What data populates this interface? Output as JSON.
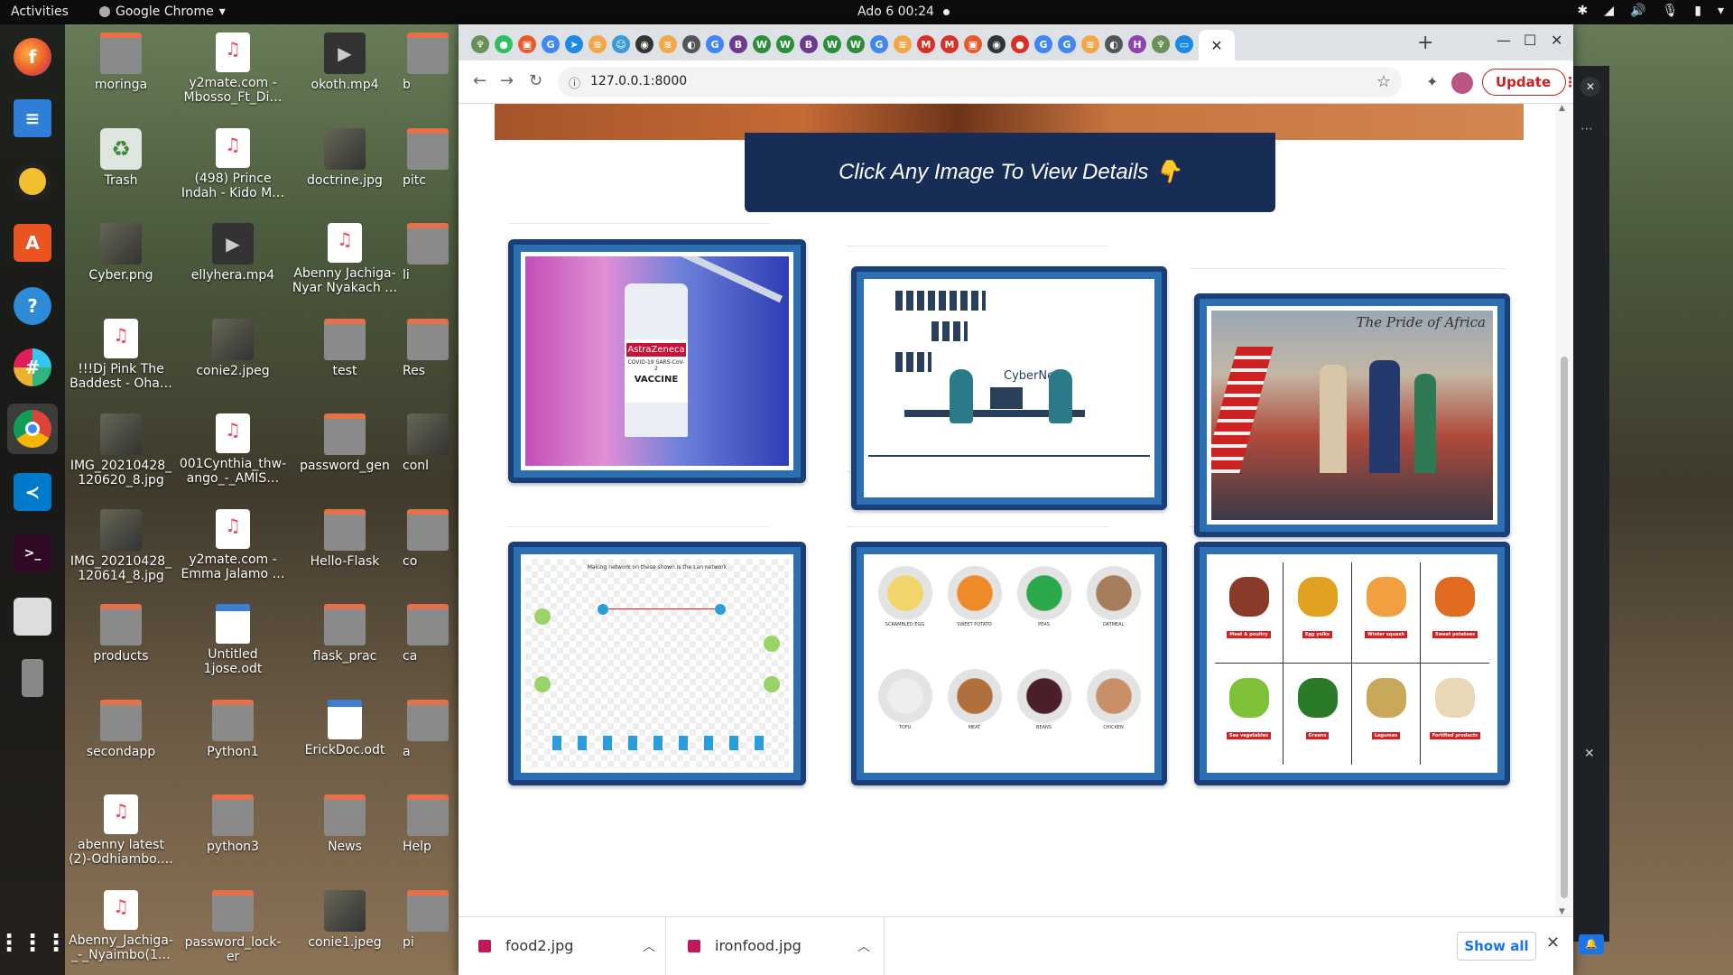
{
  "topbar": {
    "activities": "Activities",
    "app_name": "Google Chrome",
    "clock": "Ado 6  00:24"
  },
  "dock": [
    "firefox-icon",
    "writer-icon",
    "rhythmbox-icon",
    "software-icon",
    "help-icon",
    "slack-icon",
    "chrome-icon",
    "vscode-icon",
    "terminal-icon",
    "files-icon",
    "removable-drive-icon",
    "app-grid-icon"
  ],
  "desktop": {
    "col1": [
      "moringa",
      "Trash",
      "Cyber.png",
      "!!!Dj Pink The Baddest - Oha…",
      "IMG_20210428_\n120620_8.jpg",
      "IMG_20210428_\n120614_8.jpg",
      "products",
      "secondapp",
      "abenny latest (2)-Odhiambo.…",
      "Abenny_Jachiga-_-_Nyaimbo(1…"
    ],
    "col2": [
      "y2mate.com - Mbosso_Ft_Di…",
      "(498) Prince Indah - Kido M…",
      "ellyhera.mp4",
      "conie2.jpeg",
      "001Cynthia_thw-ango_-_AMIS…",
      "y2mate.com - Emma Jalamo …",
      "Untitled 1jose.odt",
      "Python1",
      "python3",
      "password_lock-er"
    ],
    "col3": [
      "okoth.mp4",
      "doctrine.jpg",
      "Abenny Jachiga- Nyar Nyakach …",
      "test",
      "password_gen",
      "Hello-Flask",
      "flask_prac",
      "ErickDoc.odt",
      "News",
      "conie1.jpeg"
    ],
    "col4": [
      "b",
      "pitc",
      "li",
      "Res",
      "conl",
      "co",
      "ca",
      "a",
      "Help",
      "pi"
    ]
  },
  "browser": {
    "url": "127.0.0.1:8000",
    "update_label": "Update",
    "banner_text": "Click Any Image To View Details 👇",
    "cards": [
      {
        "name": "astrazeneca-vaccine-image",
        "title": "AstraZeneca",
        "sub": "COVID-19 SARS-CoV-2",
        "label": "VACCINE"
      },
      {
        "name": "cybernet-illustration-image",
        "title": "CyberNet"
      },
      {
        "name": "pride-of-africa-image",
        "title": "The Pride of Africa"
      },
      {
        "name": "network-diagram-image",
        "title": "Making network on these shown is the Lan network"
      },
      {
        "name": "food-bowls-image",
        "labels": [
          "SCRAMBLED EGG",
          "SWEET POTATO",
          "PEAS",
          "OATMEAL",
          "TOFU",
          "MEAT",
          "BEANS",
          "CHICKEN"
        ]
      },
      {
        "name": "iron-food-grid-image",
        "labels": [
          "Meat & poultry",
          "Egg yolks",
          "Winter squash",
          "Sweet potatoes",
          "Sea vegetables",
          "Greens",
          "Legumes",
          "Fortified products"
        ]
      }
    ],
    "downloads": [
      "food2.jpg",
      "ironfood.jpg"
    ],
    "show_all": "Show all"
  },
  "colors": {
    "banner": "#172d55",
    "card_border": "#1a3f78",
    "update": "#c5221f"
  }
}
